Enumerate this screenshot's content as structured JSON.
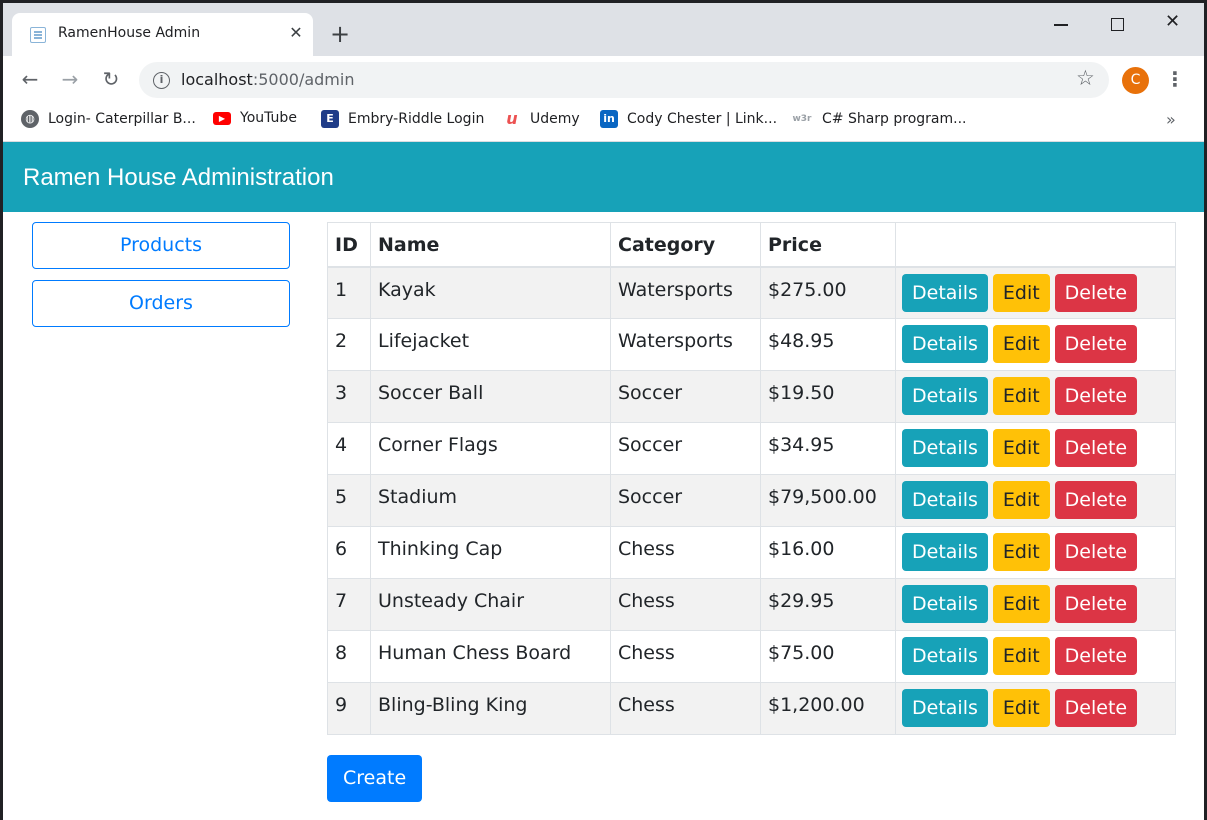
{
  "browser": {
    "tab_title": "RamenHouse Admin",
    "url_host": "localhost",
    "url_path": ":5000/admin",
    "avatar_letter": "C",
    "bookmarks": [
      {
        "label": "Login- Caterpillar B...",
        "icon": "globe-icon",
        "color": "#5f6368"
      },
      {
        "label": "YouTube",
        "icon": "youtube-icon",
        "color": "#ff0000"
      },
      {
        "label": "Embry-Riddle Login",
        "icon": "embry-riddle-icon",
        "color": "#1f3c88"
      },
      {
        "label": "Udemy",
        "icon": "udemy-icon",
        "color": "#ec5252"
      },
      {
        "label": "Cody Chester | Link...",
        "icon": "linkedin-icon",
        "color": "#0a66c2"
      },
      {
        "label": "C# Sharp program...",
        "icon": "w3r-icon",
        "color": "#9aa0a6"
      }
    ],
    "more_bookmarks": "»"
  },
  "app": {
    "title": "Ramen House Administration",
    "accent_color": "#17a2b8",
    "nav": {
      "products": "Products",
      "orders": "Orders"
    },
    "table": {
      "headers": {
        "id": "ID",
        "name": "Name",
        "category": "Category",
        "price": "Price"
      },
      "rows": [
        {
          "id": "1",
          "name": "Kayak",
          "category": "Watersports",
          "price": "$275.00"
        },
        {
          "id": "2",
          "name": "Lifejacket",
          "category": "Watersports",
          "price": "$48.95"
        },
        {
          "id": "3",
          "name": "Soccer Ball",
          "category": "Soccer",
          "price": "$19.50"
        },
        {
          "id": "4",
          "name": "Corner Flags",
          "category": "Soccer",
          "price": "$34.95"
        },
        {
          "id": "5",
          "name": "Stadium",
          "category": "Soccer",
          "price": "$79,500.00"
        },
        {
          "id": "6",
          "name": "Thinking Cap",
          "category": "Chess",
          "price": "$16.00"
        },
        {
          "id": "7",
          "name": "Unsteady Chair",
          "category": "Chess",
          "price": "$29.95"
        },
        {
          "id": "8",
          "name": "Human Chess Board",
          "category": "Chess",
          "price": "$75.00"
        },
        {
          "id": "9",
          "name": "Bling-Bling King",
          "category": "Chess",
          "price": "$1,200.00"
        }
      ],
      "actions": {
        "details": "Details",
        "edit": "Edit",
        "delete": "Delete"
      }
    },
    "create_label": "Create"
  }
}
